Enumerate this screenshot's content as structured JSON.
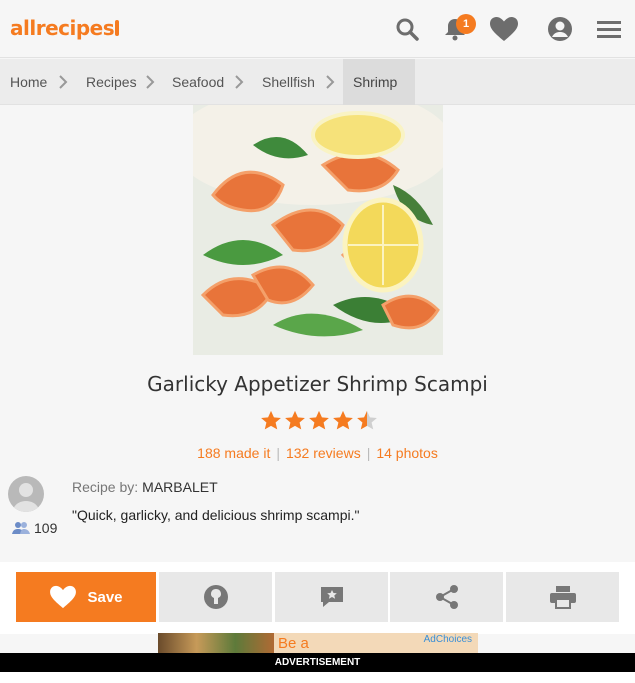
{
  "header": {
    "logo_text": "allrecipes",
    "notification_count": "1"
  },
  "breadcrumb": {
    "items": [
      {
        "label": "Home"
      },
      {
        "label": "Recipes"
      },
      {
        "label": "Seafood"
      },
      {
        "label": "Shellfish"
      },
      {
        "label": "Shrimp"
      }
    ]
  },
  "recipe": {
    "title": "Garlicky Appetizer Shrimp Scampi",
    "rating": 4.5,
    "made_it": "188 made it",
    "reviews": "132 reviews",
    "photos": "14 photos",
    "author_prefix": "Recipe by:",
    "author_name": "MARBALET",
    "followers": "109",
    "description": "\"Quick, garlicky, and delicious shrimp scampi.\""
  },
  "actions": {
    "save_label": "Save"
  },
  "ad": {
    "headline": "Be a",
    "adchoices": "AdChoices",
    "label": "ADVERTISEMENT"
  },
  "colors": {
    "brand": "#f57b20",
    "button_gray": "#e8e8e8"
  }
}
